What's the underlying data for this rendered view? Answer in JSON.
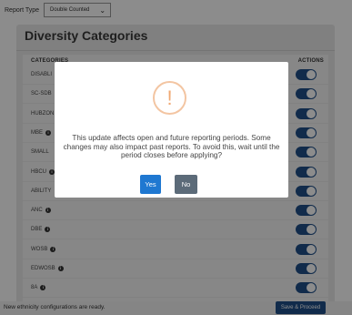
{
  "report_type": {
    "label": "Report Type",
    "selected": "Double Counted",
    "chevron_icon": "chevron-down-icon"
  },
  "panel": {
    "title": "Diversity Categories",
    "columns": {
      "categories": "CATEGORIES",
      "actions": "ACTIONS"
    },
    "rows": [
      {
        "label": "DISABLED",
        "visible_label": "DISABLI",
        "info": false,
        "enabled": true
      },
      {
        "label": "SC-SDB",
        "visible_label": "SC-SDB",
        "info": false,
        "enabled": true
      },
      {
        "label": "HUBZONE",
        "visible_label": "HUBZON",
        "info": false,
        "enabled": true
      },
      {
        "label": "MBE",
        "visible_label": "MBE",
        "info": true,
        "enabled": true
      },
      {
        "label": "SMALL",
        "visible_label": "SMALL",
        "info": false,
        "enabled": true
      },
      {
        "label": "HBCU",
        "visible_label": "HBCU",
        "info": true,
        "enabled": true
      },
      {
        "label": "ABILITY",
        "visible_label": "ABILITY",
        "info": false,
        "enabled": true
      },
      {
        "label": "ANC",
        "visible_label": "ANC",
        "info": true,
        "enabled": true
      },
      {
        "label": "DBE",
        "visible_label": "DBE",
        "info": true,
        "enabled": true
      },
      {
        "label": "WOSB",
        "visible_label": "WOSB",
        "info": true,
        "enabled": true
      },
      {
        "label": "EDWOSB",
        "visible_label": "EDWOSB",
        "info": true,
        "enabled": true
      },
      {
        "label": "8A",
        "visible_label": "8A",
        "info": true,
        "enabled": true
      }
    ]
  },
  "status": {
    "message": "New ethnicity configurations are ready."
  },
  "save_button": {
    "label": "Save & Proceed"
  },
  "modal": {
    "icon": "warning-exclamation-icon",
    "icon_glyph": "!",
    "message": "This update affects open and future reporting periods. Some changes may also impact past reports. To avoid this, wait until the period closes before applying?",
    "yes_label": "Yes",
    "no_label": "No"
  },
  "colors": {
    "accent": "#1f4f89",
    "yes": "#1f78d1",
    "no": "#5c6b79",
    "warning": "#f0a872"
  }
}
